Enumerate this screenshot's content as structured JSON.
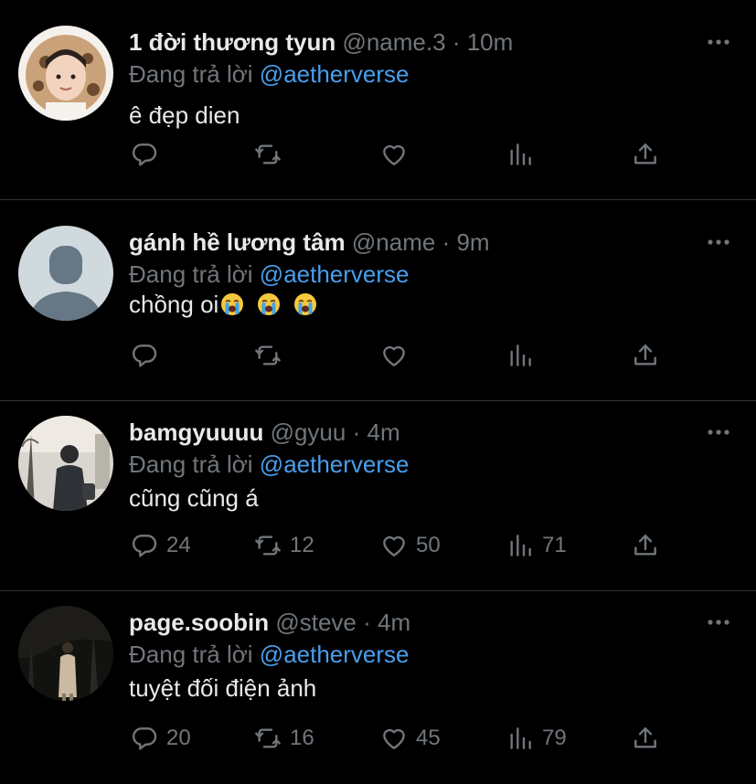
{
  "reply_prefix": "Đang trả lời",
  "colors": {
    "background": "#000000",
    "text": "#e7e9ea",
    "muted": "#71767b",
    "mention": "#4a9eed",
    "divider": "#2f3336"
  },
  "tweets": [
    {
      "display_name": "1 đời thương tyun",
      "handle": "@name.3",
      "sep": "·",
      "time": "10m",
      "reply_to": "@aetherverse",
      "text": "ê đẹp dien",
      "emojis": [],
      "avatar": "profile-photo",
      "counts": {
        "reply": "",
        "retweet": "",
        "like": "",
        "views": ""
      }
    },
    {
      "display_name": "gánh hề lương tâm",
      "handle": "@name",
      "sep": "·",
      "time": "9m",
      "reply_to": "@aetherverse",
      "text": "chồng oi",
      "emojis": [
        "loudly-crying-face-emoji",
        "loudly-crying-face-emoji",
        "loudly-crying-face-emoji"
      ],
      "avatar": "default-avatar",
      "counts": {
        "reply": "",
        "retweet": "",
        "like": "",
        "views": ""
      }
    },
    {
      "display_name": "bamgyuuuu",
      "handle": "@gyuu",
      "sep": "·",
      "time": "4m",
      "reply_to": "@aetherverse",
      "text": "cũng cũng á",
      "emojis": [],
      "avatar": "profile-photo",
      "counts": {
        "reply": "24",
        "retweet": "12",
        "like": "50",
        "views": "71"
      }
    },
    {
      "display_name": "page.soobin",
      "handle": "@steve",
      "sep": "·",
      "time": "4m",
      "reply_to": "@aetherverse",
      "text": "tuyệt đối điện ảnh",
      "emojis": [],
      "avatar": "profile-photo",
      "counts": {
        "reply": "20",
        "retweet": "16",
        "like": "45",
        "views": "79"
      }
    }
  ],
  "icons": {
    "more": "more-dots-icon",
    "reply": "reply-icon",
    "retweet": "retweet-icon",
    "like": "heart-icon",
    "views": "views-chart-icon",
    "share": "share-icon"
  }
}
